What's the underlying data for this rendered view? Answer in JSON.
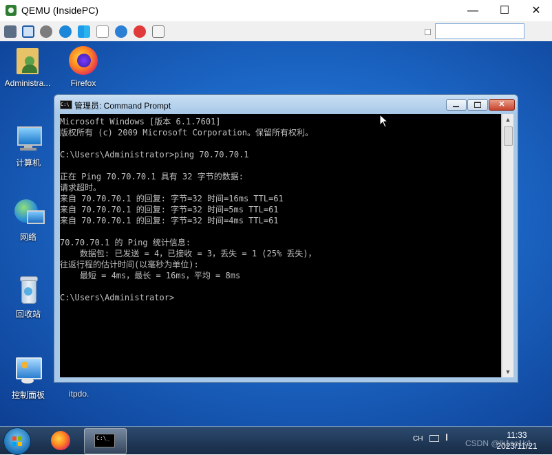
{
  "qemu": {
    "title": "QEMU (InsidePC)",
    "min": "—",
    "max": "☐",
    "close": "✕",
    "toolbar_icons": [
      "settings-icon",
      "fullscreen-icon",
      "gear-icon",
      "refresh-icon",
      "windows-icon",
      "file-icon",
      "info-icon",
      "stop-icon",
      "screenshot-icon"
    ]
  },
  "desktop": {
    "icons": [
      {
        "label": "Administra..."
      },
      {
        "label": "Firefox"
      },
      {
        "label": "计算机"
      },
      {
        "label": "网络"
      },
      {
        "label": "回收站"
      },
      {
        "label": "控制面板"
      }
    ],
    "partial_text": "itpdo."
  },
  "cmd": {
    "title": "管理员: Command Prompt",
    "cicon_text": "C:\\",
    "lines": [
      "Microsoft Windows [版本 6.1.7601]",
      "版权所有 (c) 2009 Microsoft Corporation。保留所有权利。",
      "",
      "C:\\Users\\Administrator>ping 70.70.70.1",
      "",
      "正在 Ping 70.70.70.1 具有 32 字节的数据:",
      "请求超时。",
      "来自 70.70.70.1 的回复: 字节=32 时间=16ms TTL=61",
      "来自 70.70.70.1 的回复: 字节=32 时间=5ms TTL=61",
      "来自 70.70.70.1 的回复: 字节=32 时间=4ms TTL=61",
      "",
      "70.70.70.1 的 Ping 统计信息:",
      "    数据包: 已发送 = 4，已接收 = 3，丢失 = 1 (25% 丢失)，",
      "往返行程的估计时间(以毫秒为单位):",
      "    最短 = 4ms，最长 = 16ms，平均 = 8ms",
      "",
      "C:\\Users\\Administrator>"
    ]
  },
  "taskbar": {
    "ime": "CH",
    "time": "11:33",
    "date": "2023/11/21",
    "cmd_button_text": "C:\\_"
  },
  "watermark": "CSDN @lk1sc1k1"
}
